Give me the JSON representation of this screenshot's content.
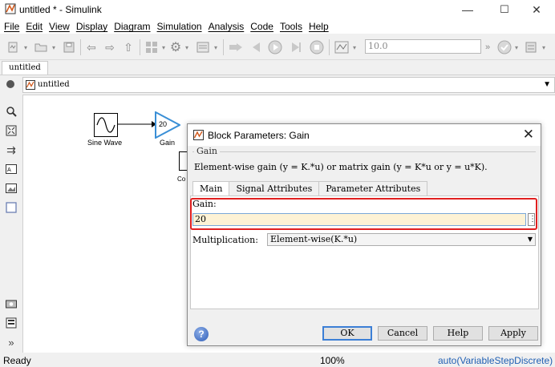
{
  "window": {
    "title": "untitled * - Simulink",
    "minimize": "—",
    "maximize": "☐",
    "close": "✕"
  },
  "menu": [
    "File",
    "Edit",
    "View",
    "Display",
    "Diagram",
    "Simulation",
    "Analysis",
    "Code",
    "Tools",
    "Help"
  ],
  "toolbar": {
    "stop_time": "10.0"
  },
  "tabs": {
    "model_tab": "untitled"
  },
  "address": {
    "path": "untitled"
  },
  "canvas": {
    "sine_wave_label": "Sine Wave",
    "gain_value": "20",
    "gain_label": "Gain",
    "partial_label": "Co"
  },
  "dialog": {
    "title": "Block Parameters: Gain",
    "close": "✕",
    "group_title": "Gain",
    "description": "Element-wise gain (y = K.*u) or matrix gain (y = K*u or y = u*K).",
    "tabs": [
      "Main",
      "Signal Attributes",
      "Parameter Attributes"
    ],
    "gain_label": "Gain:",
    "gain_value": "20",
    "gain_more": "⋮",
    "multiplication_label": "Multiplication:",
    "multiplication_value": "Element-wise(K.*u)",
    "help": "?",
    "buttons": {
      "ok": "OK",
      "cancel": "Cancel",
      "help": "Help",
      "apply": "Apply"
    }
  },
  "status": {
    "ready": "Ready",
    "zoom": "100%",
    "solver": "auto(VariableStepDiscrete)"
  },
  "colors": {
    "highlight": "#e02020",
    "gain_block": "#3a8fd6",
    "input_bg": "#fdf2d5",
    "link_blue": "#1f5fb3"
  }
}
